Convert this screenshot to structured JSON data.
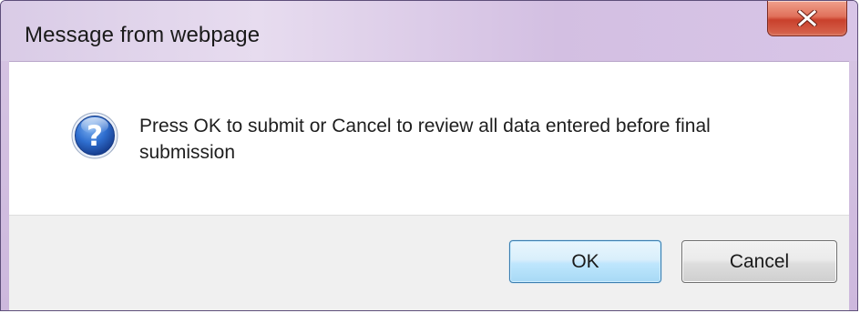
{
  "window": {
    "title": "Message from webpage",
    "close_glyph": "X",
    "close_icon": "close-icon",
    "title_bar_color": "#d9c8e6",
    "close_button_color": "#c9402c"
  },
  "dialog": {
    "icon": "question-icon",
    "icon_glyph": "?",
    "message": "Press OK to submit or Cancel to review all data entered before final\nsubmission"
  },
  "buttons": {
    "ok_label": "OK",
    "cancel_label": "Cancel"
  }
}
